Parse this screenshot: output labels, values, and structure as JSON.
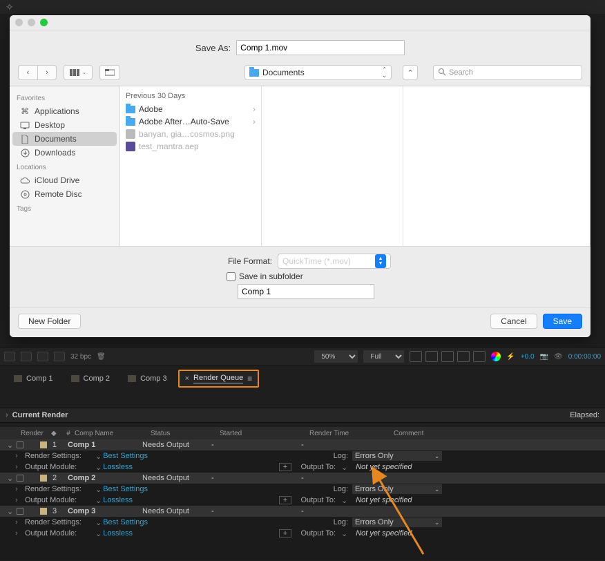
{
  "dialog": {
    "save_as_label": "Save As:",
    "filename": "Comp 1.mov",
    "location": "Documents",
    "search_placeholder": "Search",
    "sidebar": {
      "favorites_head": "Favorites",
      "favorites": [
        "Applications",
        "Desktop",
        "Documents",
        "Downloads"
      ],
      "selected": "Documents",
      "locations_head": "Locations",
      "locations": [
        "iCloud Drive",
        "Remote Disc"
      ],
      "tags_head": "Tags"
    },
    "column": {
      "head": "Previous 30 Days",
      "items": [
        {
          "name": "Adobe",
          "type": "folder",
          "dim": false,
          "children": true
        },
        {
          "name": "Adobe After…Auto-Save",
          "type": "folder",
          "dim": false,
          "children": true
        },
        {
          "name": "banyan, gia…cosmos.png",
          "type": "file",
          "dim": true,
          "children": false
        },
        {
          "name": "test_mantra.aep",
          "type": "aep",
          "dim": true,
          "children": false
        }
      ]
    },
    "format_label": "File Format:",
    "format_value": "QuickTime (*.mov)",
    "subfolder_label": "Save in subfolder",
    "subfolder_value": "Comp 1",
    "new_folder": "New Folder",
    "cancel": "Cancel",
    "save": "Save"
  },
  "ae_strip": {
    "bpc": "32 bpc",
    "zoom": "50%",
    "res": "Full",
    "exposure": "+0.0",
    "timecode": "0:00:00:00"
  },
  "tabs": {
    "comps": [
      "Comp 1",
      "Comp 2",
      "Comp 3"
    ],
    "render_queue": "Render Queue"
  },
  "current_render": {
    "label": "Current Render",
    "elapsed_label": "Elapsed:"
  },
  "headers": {
    "render": "Render",
    "num": "#",
    "comp": "Comp Name",
    "status": "Status",
    "started": "Started",
    "time": "Render Time",
    "comment": "Comment"
  },
  "queue": [
    {
      "num": "1",
      "name": "Comp 1",
      "status": "Needs Output"
    },
    {
      "num": "2",
      "name": "Comp 2",
      "status": "Needs Output"
    },
    {
      "num": "3",
      "name": "Comp 3",
      "status": "Needs Output"
    }
  ],
  "details": {
    "rs_label": "Render Settings:",
    "rs_value": "Best Settings",
    "om_label": "Output Module:",
    "om_value": "Lossless",
    "log_label": "Log:",
    "log_value": "Errors Only",
    "out_label": "Output To:",
    "out_value": "Not yet specified"
  }
}
